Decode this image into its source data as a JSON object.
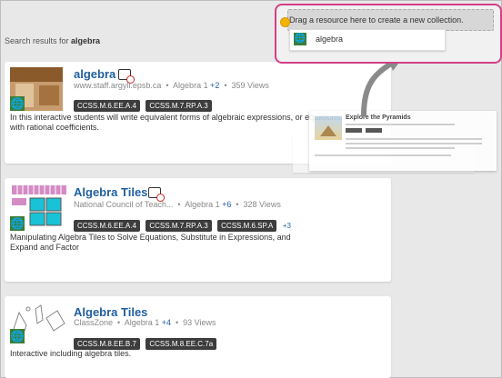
{
  "search": {
    "prefix": "Search results for",
    "query": "algebra"
  },
  "dropzone": {
    "instruction": "Drag a resource here to create a new collection.",
    "item_label": "algebra",
    "item_icon": "globe-icon",
    "border_color": "#d23f86"
  },
  "ghost_card": {
    "title": "Explore the Pyramids"
  },
  "results": [
    {
      "title": "algebra",
      "source": "www.staff.argyll.epsb.ca",
      "subject": "Algebra 1",
      "more_subjects": "+2",
      "views": "359 Views",
      "tags": [
        "CCSS.M.6.EE.A.4",
        "CCSS.M.7.RP.A.3"
      ],
      "description": "In this interactive students will write equivalent forms of algebraic expressions, or equations, with rational coefficients."
    },
    {
      "title": "Algebra Tiles",
      "source": "National Council of Teach...",
      "subject": "Algebra 1",
      "more_subjects": "+6",
      "views": "328 Views",
      "tags": [
        "CCSS.M.6.EE.A.4",
        "CCSS.M.7.RP.A.3",
        "CCSS.M.6.SP.A"
      ],
      "more_tags": "+3",
      "description": "Manipulating Algebra Tiles to Solve Equations, Substitute in Expressions, and Expand and Factor"
    },
    {
      "title": "Algebra Tiles",
      "source": "ClassZone",
      "subject": "Algebra 1",
      "more_subjects": "+4",
      "views": "93 Views",
      "tags": [
        "CCSS.M.8.EE.B.7",
        "CCSS.M.8.EE.C.7a"
      ],
      "description": "Interactive including algebra tiles."
    }
  ],
  "colors": {
    "title": "#1f5f9e",
    "tag_bg": "#3d3d3d",
    "globe": "#3b7d3b"
  }
}
